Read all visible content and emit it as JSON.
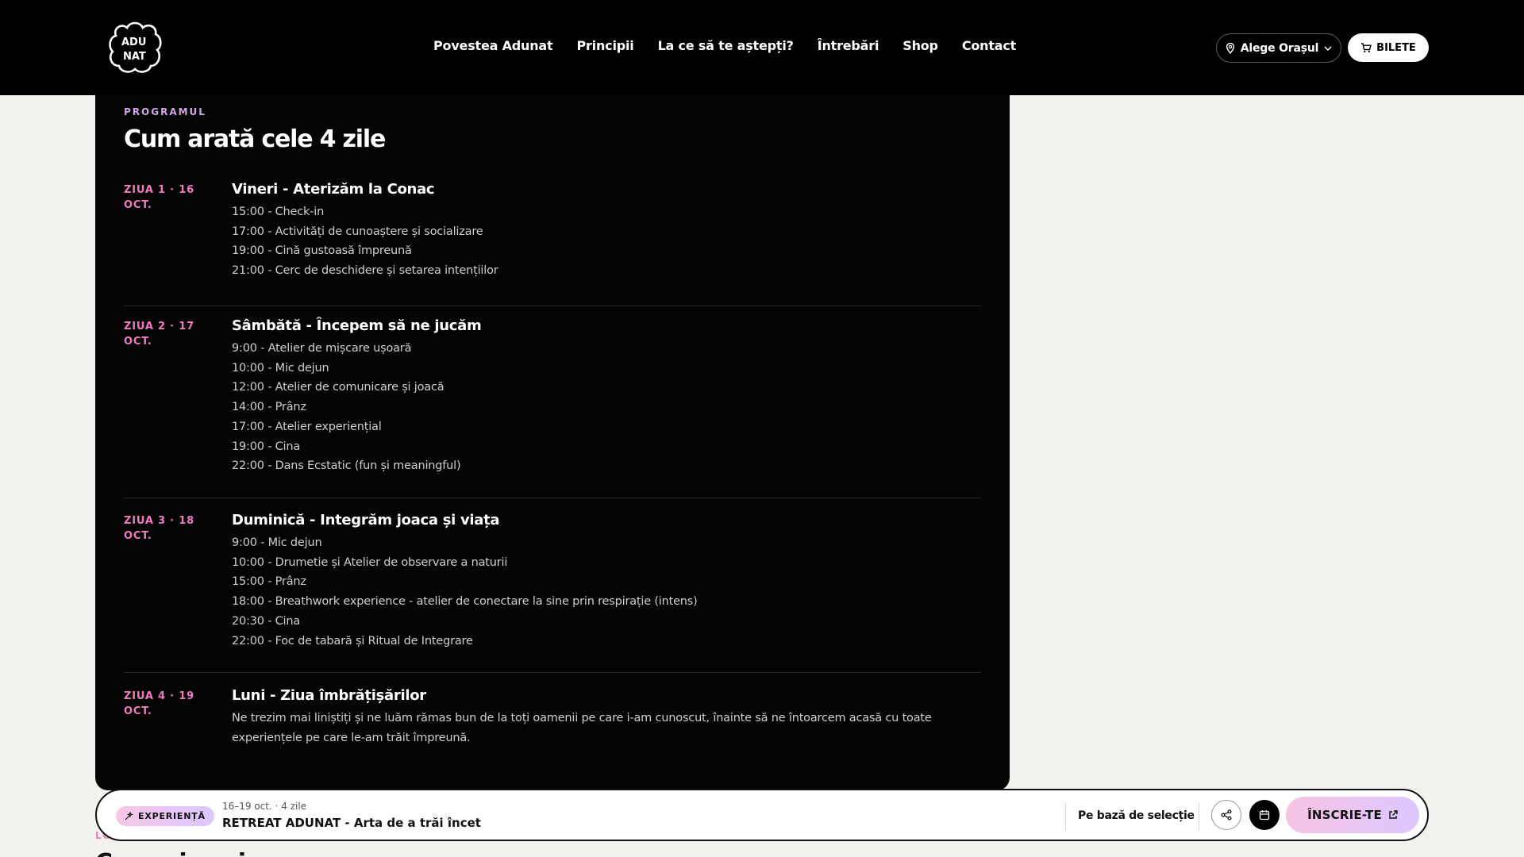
{
  "header": {
    "logo_alt": "ADUNAT",
    "nav": [
      "Povestea Adunat",
      "Principii",
      "La ce să te aștepți?",
      "Întrebări",
      "Shop",
      "Contact"
    ],
    "city_button": "Alege Orașul",
    "tickets_button": "BILETE"
  },
  "program": {
    "eyebrow": "PROGRAMUL",
    "title": "Cum arată cele 4 zile",
    "days": [
      {
        "label": "ZIUA 1 · 16 OCT.",
        "title": "Vineri - Aterizăm la Conac",
        "items": [
          "15:00 - Check-in",
          "17:00 - Activități de cunoaștere și socializare",
          "19:00 - Cină gustoasă împreună",
          "21:00 - Cerc de deschidere și setarea intențiilor"
        ]
      },
      {
        "label": "ZIUA 2 · 17 OCT.",
        "title": "Sâmbătă - Începem să ne jucăm",
        "items": [
          "9:00 - Atelier de mișcare ușoară",
          "10:00 - Mic dejun",
          "12:00 - Atelier de comunicare și joacă",
          "14:00 - Prânz",
          "17:00 - Atelier experiențial",
          "19:00 - Cina",
          "22:00 - Dans Ecstatic (fun și meaningful)"
        ]
      },
      {
        "label": "ZIUA 3 · 18 OCT.",
        "title": "Duminică - Integrăm joaca și viața",
        "items": [
          "9:00 - Mic dejun",
          "10:00 - Drumetie și Atelier de observare a naturii",
          "15:00 - Prânz",
          "18:00 - Breathwork experience - atelier de conectare la sine prin respirație (intens)",
          "20:30 - Cina",
          "22:00 - Foc de tabară și Ritual de Integrare"
        ]
      },
      {
        "label": "ZIUA 4 · 19 OCT.",
        "title": "Luni - Ziua îmbrățișărilor",
        "items": [
          "Ne trezim mai liniștiți și ne luăm rămas bun de la toți oamenii pe care i-am cunoscut, înainte să ne întoarcem acasă cu toate experiențele pe care le-am trăit împreună."
        ]
      }
    ]
  },
  "bottom_bar": {
    "badge": "EXPERIENȚĂ",
    "date": "16–19 oct. · 4 zile",
    "title": "RETREAT ADUNAT - Arta de a trăi încet",
    "selection": "Pe bază de selecție",
    "signup": "ÎNSCRIE-TE"
  },
  "colors": {
    "accent_pink": "#f07cc0",
    "accent_lilac": "#d3a6e6",
    "background": "#f2f1ed",
    "panel": "#040404"
  }
}
